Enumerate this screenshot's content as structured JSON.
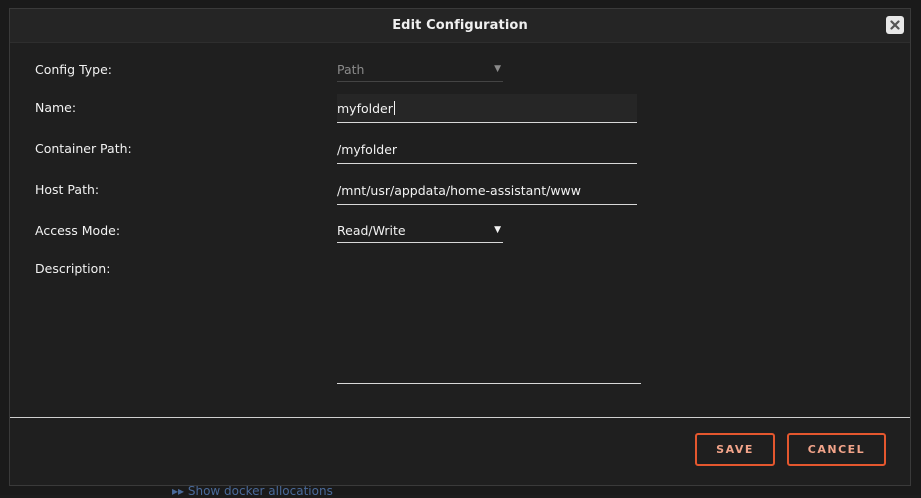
{
  "dialog": {
    "title": "Edit Configuration",
    "close_icon": "close-icon"
  },
  "form": {
    "config_type": {
      "label": "Config Type:",
      "value": "Path"
    },
    "name": {
      "label": "Name:",
      "value": "myfolder"
    },
    "container_path": {
      "label": "Container Path:",
      "value": "/myfolder"
    },
    "host_path": {
      "label": "Host Path:",
      "value": "/mnt/usr/appdata/home-assistant/www"
    },
    "access_mode": {
      "label": "Access Mode:",
      "value": "Read/Write"
    },
    "description": {
      "label": "Description:",
      "value": ""
    }
  },
  "buttons": {
    "save": "SAVE",
    "cancel": "CANCEL"
  },
  "background": {
    "link_text": "▸▸ Show docker allocations"
  },
  "colors": {
    "accent": "#e4572e",
    "dialog_bg": "#1f1f1f",
    "text": "#f2f2f2",
    "disabled_text": "#8a8a8a"
  }
}
